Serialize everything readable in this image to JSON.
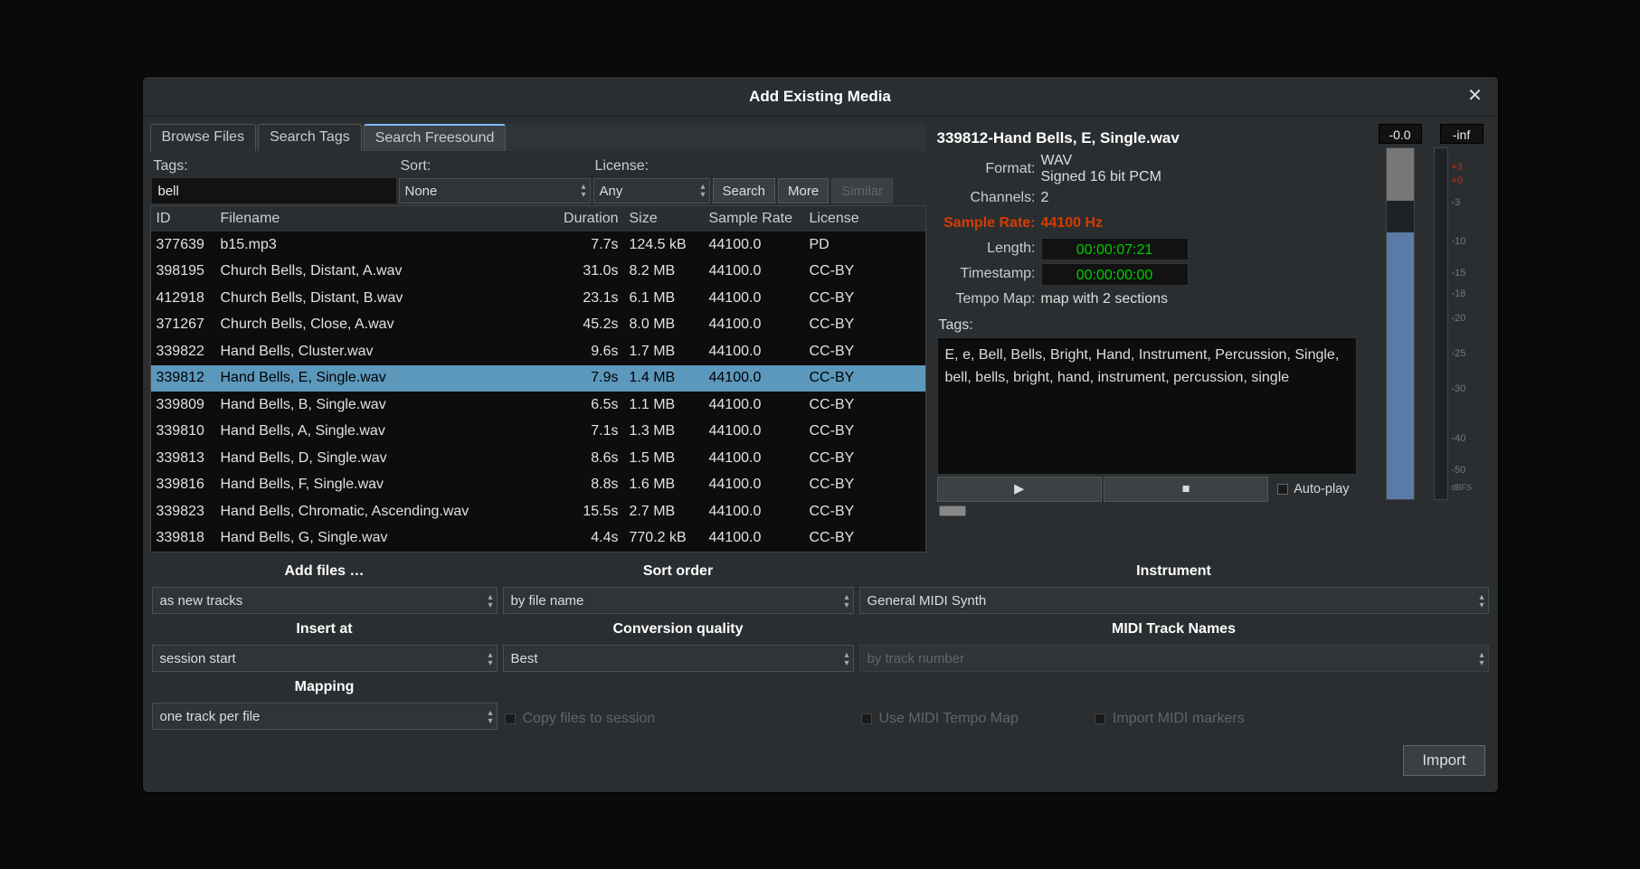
{
  "window": {
    "title": "Add Existing Media"
  },
  "tabs": [
    "Browse Files",
    "Search Tags",
    "Search Freesound"
  ],
  "active_tab": 2,
  "search": {
    "tags_label": "Tags:",
    "tags_value": "bell",
    "sort_label": "Sort:",
    "sort_value": "None",
    "license_label": "License:",
    "license_value": "Any",
    "search_btn": "Search",
    "more_btn": "More",
    "similar_btn": "Similar"
  },
  "columns": [
    "ID",
    "Filename",
    "Duration",
    "Size",
    "Sample Rate",
    "License"
  ],
  "rows": [
    {
      "id": "377639",
      "fn": "b15.mp3",
      "dur": "7.7s",
      "size": "124.5 kB",
      "sr": "44100.0",
      "lic": "PD"
    },
    {
      "id": "398195",
      "fn": "Church Bells, Distant, A.wav",
      "dur": "31.0s",
      "size": "8.2 MB",
      "sr": "44100.0",
      "lic": "CC-BY"
    },
    {
      "id": "412918",
      "fn": "Church Bells, Distant, B.wav",
      "dur": "23.1s",
      "size": "6.1 MB",
      "sr": "44100.0",
      "lic": "CC-BY"
    },
    {
      "id": "371267",
      "fn": "Church Bells, Close, A.wav",
      "dur": "45.2s",
      "size": "8.0 MB",
      "sr": "44100.0",
      "lic": "CC-BY"
    },
    {
      "id": "339822",
      "fn": "Hand Bells, Cluster.wav",
      "dur": "9.6s",
      "size": "1.7 MB",
      "sr": "44100.0",
      "lic": "CC-BY"
    },
    {
      "id": "339812",
      "fn": "Hand Bells, E, Single.wav",
      "dur": "7.9s",
      "size": "1.4 MB",
      "sr": "44100.0",
      "lic": "CC-BY",
      "selected": true
    },
    {
      "id": "339809",
      "fn": "Hand Bells, B, Single.wav",
      "dur": "6.5s",
      "size": "1.1 MB",
      "sr": "44100.0",
      "lic": "CC-BY"
    },
    {
      "id": "339810",
      "fn": "Hand Bells, A, Single.wav",
      "dur": "7.1s",
      "size": "1.3 MB",
      "sr": "44100.0",
      "lic": "CC-BY"
    },
    {
      "id": "339813",
      "fn": "Hand Bells, D, Single.wav",
      "dur": "8.6s",
      "size": "1.5 MB",
      "sr": "44100.0",
      "lic": "CC-BY"
    },
    {
      "id": "339816",
      "fn": "Hand Bells, F, Single.wav",
      "dur": "8.8s",
      "size": "1.6 MB",
      "sr": "44100.0",
      "lic": "CC-BY"
    },
    {
      "id": "339823",
      "fn": "Hand Bells, Chromatic, Ascending.wav",
      "dur": "15.5s",
      "size": "2.7 MB",
      "sr": "44100.0",
      "lic": "CC-BY"
    },
    {
      "id": "339818",
      "fn": "Hand Bells, G, Single.wav",
      "dur": "4.4s",
      "size": "770.2 kB",
      "sr": "44100.0",
      "lic": "CC-BY"
    }
  ],
  "info": {
    "title": "339812-Hand Bells, E, Single.wav",
    "format_label": "Format:",
    "format_line1": "WAV",
    "format_line2": "Signed 16 bit PCM",
    "channels_label": "Channels:",
    "channels_value": "2",
    "sr_label": "Sample Rate:",
    "sr_value": "44100 Hz",
    "length_label": "Length:",
    "length_value": "00:00:07:21",
    "timestamp_label": "Timestamp:",
    "timestamp_value": "00:00:00:00",
    "tempo_label": "Tempo Map:",
    "tempo_value": "map with 2 sections",
    "tags_label": "Tags:",
    "tags_text": "E,  e, Bell, Bells, Bright, Hand, Instrument, Percussion, Single, bell, bells, bright, hand, instrument, percussion, single",
    "autoplay_label": "Auto-play"
  },
  "meters": {
    "left_readout": "-0.0",
    "right_readout": "-inf",
    "ticks": [
      {
        "pos": 4,
        "label": "+3",
        "red": true
      },
      {
        "pos": 8,
        "label": "+0",
        "red": true
      },
      {
        "pos": 14,
        "label": "-3"
      },
      {
        "pos": 25,
        "label": "-10"
      },
      {
        "pos": 34,
        "label": "-15"
      },
      {
        "pos": 40,
        "label": "-18"
      },
      {
        "pos": 47,
        "label": "-20"
      },
      {
        "pos": 57,
        "label": "-25"
      },
      {
        "pos": 67,
        "label": "-30"
      },
      {
        "pos": 81,
        "label": "-40"
      },
      {
        "pos": 90,
        "label": "-50"
      }
    ],
    "unit": "dBFS"
  },
  "options": {
    "add_files_label": "Add files …",
    "add_files_value": "as new tracks",
    "insert_at_label": "Insert at",
    "insert_at_value": "session start",
    "mapping_label": "Mapping",
    "mapping_value": "one track per file",
    "sort_order_label": "Sort order",
    "sort_order_value": "by file name",
    "conv_label": "Conversion quality",
    "conv_value": "Best",
    "copy_files": "Copy files to session",
    "instrument_label": "Instrument",
    "instrument_value": "General MIDI Synth",
    "midi_names_label": "MIDI Track Names",
    "midi_names_value": "by track number",
    "use_midi_tempo": "Use MIDI Tempo Map",
    "import_midi": "Import MIDI markers"
  },
  "footer": {
    "import_btn": "Import"
  }
}
